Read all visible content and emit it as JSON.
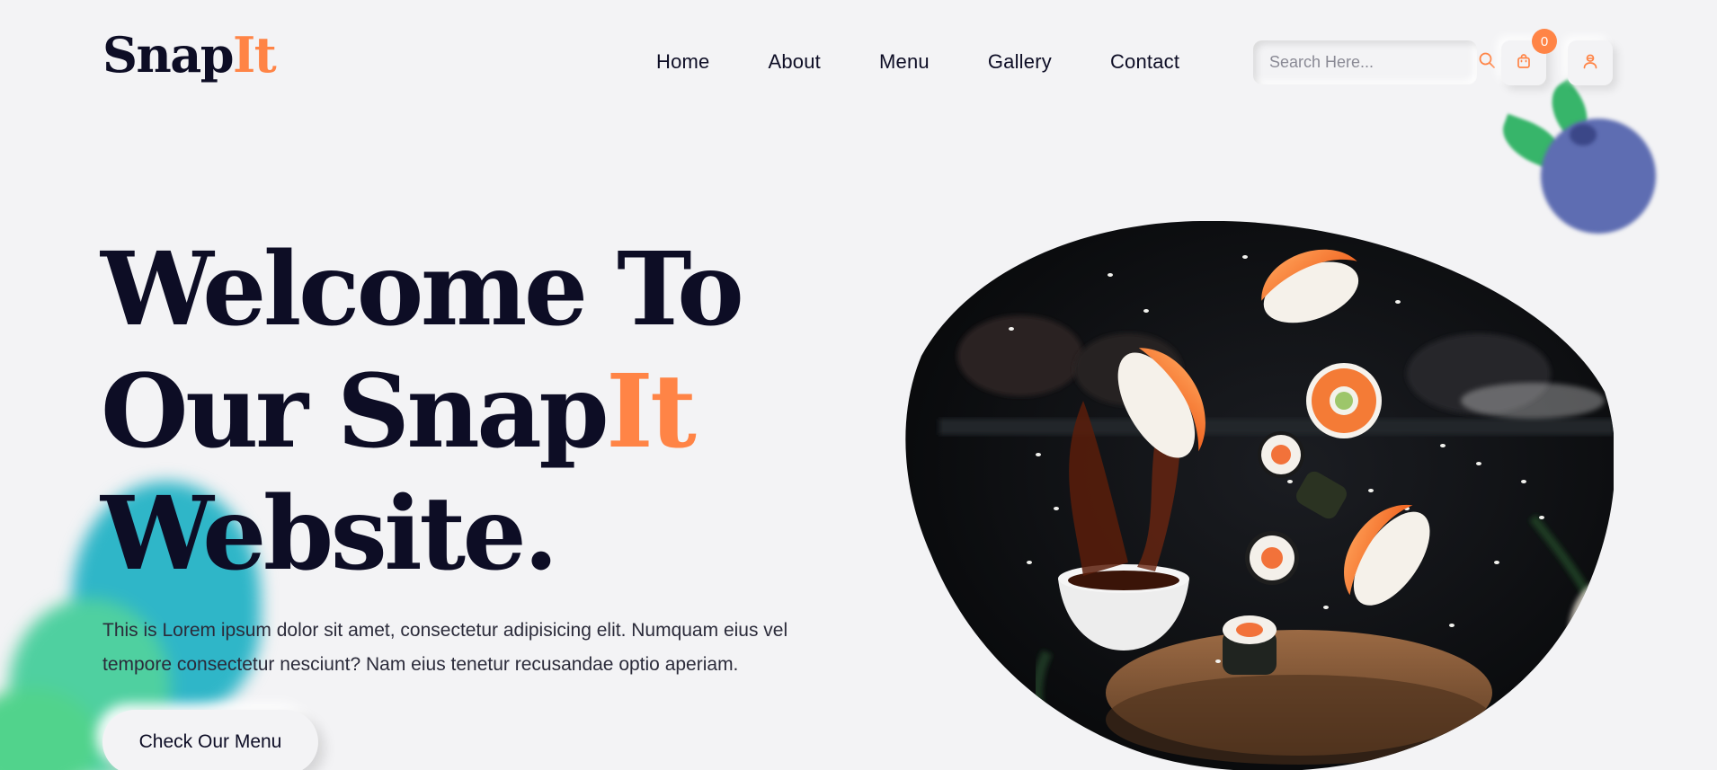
{
  "brand": {
    "name_main": "Snap",
    "name_accent": "It"
  },
  "nav": {
    "items": [
      {
        "label": "Home"
      },
      {
        "label": "About"
      },
      {
        "label": "Menu"
      },
      {
        "label": "Gallery"
      },
      {
        "label": "Contact"
      }
    ]
  },
  "search": {
    "placeholder": "Search Here..."
  },
  "cart": {
    "count": "0"
  },
  "hero": {
    "title_line1": "Welcome To",
    "title_line2_main": "Our Snap",
    "title_line2_accent": "It",
    "title_line3": "Website.",
    "description": "This is Lorem ipsum dolor sit amet, consectetur adipisicing elit. Numquam eius vel tempore consectetur nesciunt? Nam eius tenetur recusandae optio aperiam.",
    "cta_label": "Check Our Menu"
  },
  "colors": {
    "accent": "#ff8446",
    "dark": "#0d0d25",
    "background": "#f3f3f5"
  },
  "icons": {
    "search": "search-icon",
    "cart": "shopping-bag-icon",
    "user": "user-icon"
  }
}
